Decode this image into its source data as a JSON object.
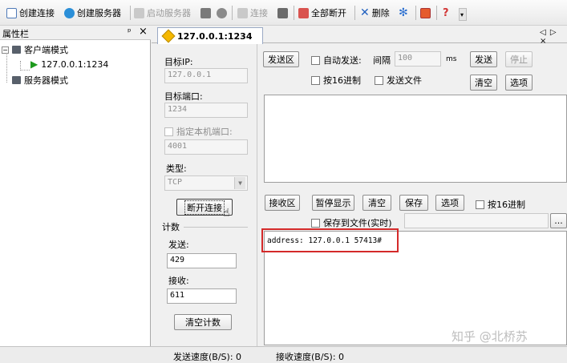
{
  "toolbar": {
    "create_connection": "创建连接",
    "create_server": "创建服务器",
    "start_server": "启动服务器",
    "connect": "连接",
    "disconnect_all": "全部断开",
    "delete": "删除"
  },
  "sidebar": {
    "title": "属性栏",
    "pin": "ᵖ",
    "close": "×",
    "client_mode": "客户端模式",
    "client_conn": "127.0.0.1:1234",
    "server_mode": "服务器模式"
  },
  "tab": {
    "label": "127.0.0.1:1234",
    "nav": "◁ ▷ ×"
  },
  "left": {
    "target_ip_label": "目标IP:",
    "target_ip": "127.0.0.1",
    "target_port_label": "目标端口:",
    "target_port": "1234",
    "local_port_label": "指定本机端口:",
    "local_port": "4001",
    "type_label": "类型:",
    "type_value": "TCP",
    "disconnect": "断开连接",
    "count_label": "计数",
    "send_label": "发送:",
    "send_count": "429",
    "recv_label": "接收:",
    "recv_count": "611",
    "clear_count": "清空计数"
  },
  "send": {
    "title": "发送区",
    "auto_send": "自动发送:",
    "interval_label": "间隔",
    "interval_value": "100",
    "interval_unit": "ms",
    "send_btn": "发送",
    "stop_btn": "停止",
    "hex": "按16进制",
    "send_file": "发送文件",
    "clear_btn": "清空",
    "options_btn": "选项"
  },
  "recv": {
    "title": "接收区",
    "pause": "暂停显示",
    "clear": "清空",
    "save": "保存",
    "options": "选项",
    "hex": "按16进制",
    "save_file": "保存到文件(实时)",
    "browse": "...",
    "content": "address: 127.0.0.1 57413#"
  },
  "status": {
    "send_speed": "发送速度(B/S): 0",
    "recv_speed": "接收速度(B/S): 0"
  },
  "watermark": "知乎 @北桥苏",
  "colors": {
    "highlight_border": "#d42a2a",
    "tab_accent": "#f5b800"
  }
}
